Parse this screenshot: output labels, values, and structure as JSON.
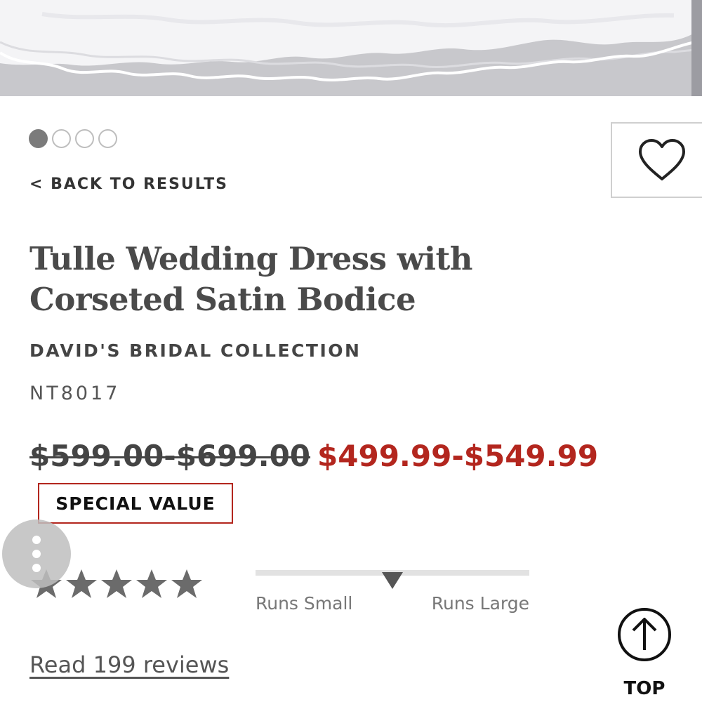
{
  "hero": {
    "icon": "dress-photo"
  },
  "carousel": {
    "count": 4,
    "active_index": 0
  },
  "nav": {
    "back_label": "< BACK TO RESULTS"
  },
  "favorite": {
    "icon": "heart-icon"
  },
  "product": {
    "title": "Tulle Wedding Dress with Corseted Satin Bodice",
    "brand": "DAVID'S BRIDAL COLLECTION",
    "sku": "NT8017",
    "price_original": "$599.00-$699.00",
    "price_sale": "$499.99-$549.99",
    "badge": "SPECIAL VALUE"
  },
  "rating": {
    "stars": 5,
    "filled": 5,
    "reviews_link": "Read 199 reviews"
  },
  "fit": {
    "left_label": "Runs Small",
    "right_label": "Runs Large",
    "position": 0.5
  },
  "top_button": {
    "label": "TOP",
    "icon": "arrow-up-circle-icon"
  },
  "colors": {
    "sale": "#b3261e",
    "text": "#4a4a4a",
    "star": "#6b6b6b"
  }
}
